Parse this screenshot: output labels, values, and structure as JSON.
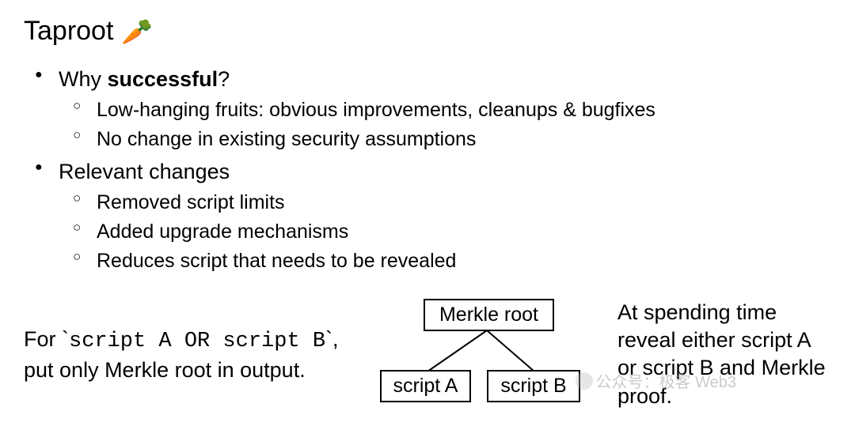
{
  "title": "Taproot",
  "icon_name": "carrot",
  "bullets": {
    "item1": {
      "prefix": "Why ",
      "bold": "successful",
      "suffix": "?",
      "sub": [
        "Low-hanging fruits: obvious improvements, cleanups & bugfixes",
        "No change in existing security assumptions"
      ]
    },
    "item2": {
      "text": "Relevant changes",
      "sub": [
        "Removed script limits",
        "Added upgrade mechanisms",
        "Reduces script that needs to be revealed"
      ]
    }
  },
  "bottom": {
    "left_line1_prefix": "For `",
    "left_line1_code": "script A OR script B",
    "left_line1_suffix": "`,",
    "left_line2": "put only Merkle root in output.",
    "right": "At spending time reveal either script A or script B and Merkle proof."
  },
  "diagram": {
    "root": "Merkle root",
    "leaf_a": "script A",
    "leaf_b": "script B"
  },
  "watermark": "公众号：极客 Web3"
}
